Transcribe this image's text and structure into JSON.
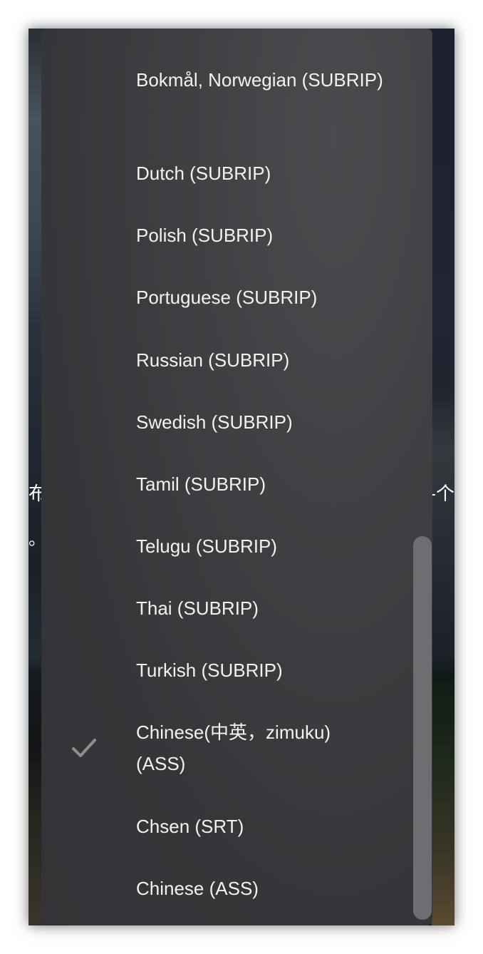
{
  "subtitle_menu": {
    "items": [
      {
        "label": "Bokmål, Norwegian (SUBRIP)",
        "selected": false
      },
      {
        "label": "Dutch (SUBRIP)",
        "selected": false
      },
      {
        "label": "Polish (SUBRIP)",
        "selected": false
      },
      {
        "label": "Portuguese (SUBRIP)",
        "selected": false
      },
      {
        "label": "Russian (SUBRIP)",
        "selected": false
      },
      {
        "label": "Swedish (SUBRIP)",
        "selected": false
      },
      {
        "label": "Tamil (SUBRIP)",
        "selected": false
      },
      {
        "label": "Telugu (SUBRIP)",
        "selected": false
      },
      {
        "label": "Thai (SUBRIP)",
        "selected": false
      },
      {
        "label": "Turkish (SUBRIP)",
        "selected": false
      },
      {
        "label": "Chinese(中英，zimuku)(ASS)",
        "selected": true
      },
      {
        "label": "Chsen (SRT)",
        "selected": false
      },
      {
        "label": "Chinese (ASS)",
        "selected": false
      }
    ],
    "check_icon": "checkmark-icon",
    "text_color": "#f2f2f2",
    "check_color": "#8e8e90"
  },
  "background": {
    "left_char": "布",
    "left_dot": "。",
    "right_char": "-个"
  }
}
